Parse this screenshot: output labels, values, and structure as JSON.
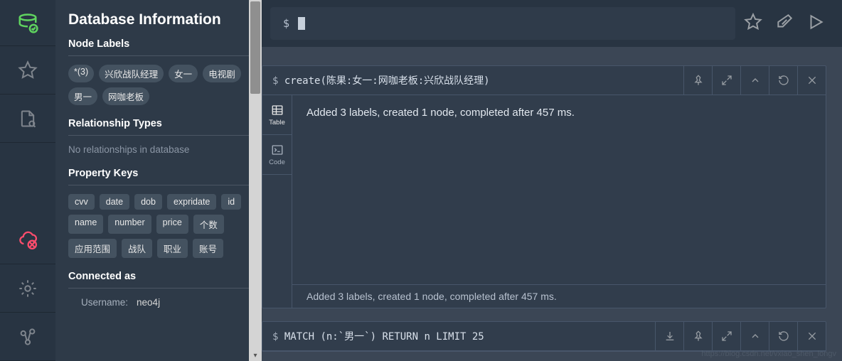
{
  "sidebar": {
    "title": "Database Information",
    "labels_heading": "Node Labels",
    "labels": [
      "*(3)",
      "兴欣战队经理",
      "女一",
      "电视剧",
      "男一",
      "网咖老板"
    ],
    "rel_heading": "Relationship Types",
    "rel_empty": "No relationships in database",
    "prop_heading": "Property Keys",
    "props": [
      "cvv",
      "date",
      "dob",
      "expridate",
      "id",
      "name",
      "number",
      "price",
      "个数",
      "应用范围",
      "战队",
      "职业",
      "账号"
    ],
    "conn_heading": "Connected as",
    "conn_user_label": "Username:",
    "conn_user_value": "neo4j"
  },
  "editor": {
    "prompt": "$"
  },
  "results": [
    {
      "prompt": "$",
      "query_display": " create(陈果:女一:网咖老板:兴欣战队经理)",
      "body": "Added 3 labels, created 1 node, completed after 457 ms.",
      "footer": "Added 3 labels, created 1 node, completed after 457 ms.",
      "tabs": {
        "table": "Table",
        "code": "Code"
      }
    },
    {
      "prompt": "$",
      "query_display": " MATCH (n:`男一`) RETURN n LIMIT 25"
    }
  ],
  "watermark": "https://blog.csdn.net/vxiao_shen_longv"
}
